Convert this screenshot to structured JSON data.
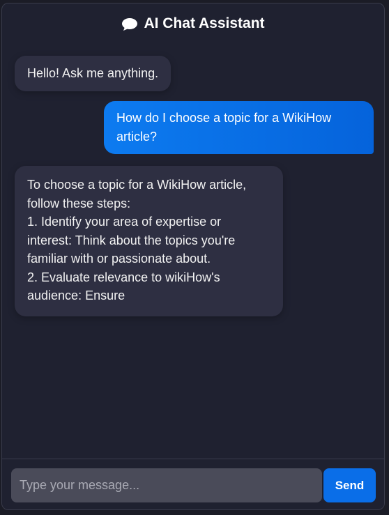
{
  "header": {
    "title": "AI Chat Assistant",
    "icon": "speech-bubble-icon"
  },
  "messages": [
    {
      "role": "assistant",
      "lines": [
        "Hello! Ask me anything."
      ]
    },
    {
      "role": "user",
      "lines": [
        "How do I choose a topic for a WikiHow",
        "article?"
      ]
    },
    {
      "role": "assistant",
      "lines": [
        "To choose a topic for a WikiHow article,",
        "follow these steps:",
        "1. Identify your area of expertise or",
        "interest: Think about the topics you're",
        "familiar with or passionate about.",
        "2. Evaluate relevance to wikiHow's",
        "audience: Ensure"
      ]
    }
  ],
  "composer": {
    "placeholder": "Type your message...",
    "value": "",
    "send_label": "Send"
  },
  "colors": {
    "background": "#1f2130",
    "assistant_bubble": "#2e2f42",
    "user_bubble": "#0a6ee8",
    "input": "#4a4b59",
    "accent": "#0a6ee8"
  }
}
